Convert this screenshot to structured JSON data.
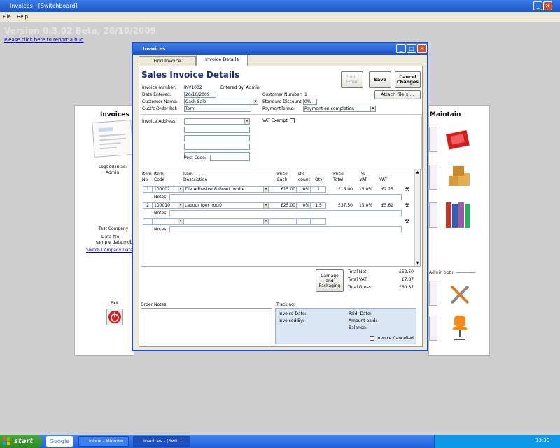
{
  "app": {
    "title": "Invoices - [Switchboard]",
    "menu": [
      "File",
      "Help"
    ],
    "version": "Version 0.3.02 Beta, 28/10/2009",
    "bug_link": "Please click here to report a bug"
  },
  "left_panel": {
    "title": "Invoices",
    "logged_in_label": "Logged in as:",
    "user": "Admin",
    "company": "Test Company",
    "data_file_label": "Data file:",
    "data_file": "sample data.mdb",
    "switch_link": "Switch Company Data",
    "exit_label": "Exit"
  },
  "right_panel": {
    "title": "Maintain",
    "admin_options": "Admin options"
  },
  "dialog": {
    "title": "Invoices",
    "tabs": [
      "Find Invoice",
      "Invoice Details"
    ],
    "active_tab": "Invoice Details",
    "heading": "Sales Invoice Details",
    "buttons": {
      "print": "Print / Email",
      "save": "Save",
      "cancel": "Cancel Changes",
      "attach": "Attach file(s)...",
      "carriage": "Carriage and Packaging"
    },
    "fields": {
      "invoice_number_label": "Invoice number:",
      "invoice_number": "INV1002",
      "entered_by": "Entered By: Admin",
      "date_entered_label": "Date Entered:",
      "date_entered": "26/10/2009",
      "customer_name_label": "Customer Name:",
      "customer_name": "Cash Sale",
      "order_ref_label": "Cust's Order Ref:",
      "order_ref": "Tom",
      "customer_number_label": "Customer Number:",
      "customer_number": "1",
      "discount_label": "Standard Discount:",
      "discount": "0%",
      "payment_terms_label": "PaymentTerms:",
      "payment_terms": "Payment on completion",
      "invoice_address_label": "Invoice Address:",
      "post_code_label": "Post Code:",
      "vat_exempt_label": "VAT Exempt"
    },
    "table": {
      "headers": {
        "no": "Item No",
        "code": "Item Code",
        "desc": "Item Description",
        "price_each": "Price Each",
        "discount": "Dis- count",
        "qty": "Qty",
        "price_total": "Price Total",
        "vat_pct": "% VAT",
        "vat": "VAT"
      },
      "notes_label": "Notes:",
      "rows": [
        {
          "no": "1",
          "code": "100002",
          "desc": "Tile Adhesive & Grout, white",
          "price": "£15.00",
          "disc": "0%",
          "qty": "1",
          "total": "£15.00",
          "vat_pct": "15.0%",
          "vat": "£2.25"
        },
        {
          "no": "2",
          "code": "100010",
          "desc": "Labour (per hour)",
          "price": "£25.00",
          "disc": "0%",
          "qty": "1.5",
          "total": "£37.50",
          "vat_pct": "15.0%",
          "vat": "£5.62"
        }
      ]
    },
    "totals": {
      "net_label": "Total Net:",
      "net": "£52.50",
      "vat_label": "Total VAT:",
      "vat": "£7.87",
      "gross_label": "Total Gross:",
      "gross": "£60.37"
    },
    "order_notes_label": "Order Notes:",
    "tracking": {
      "label": "Tracking:",
      "invoice_date": "Invoice Date:",
      "invoiced_by": "Invoiced By:",
      "paid_date": "Paid, Date:",
      "amount_paid": "Amount paid:",
      "balance": "Balance:",
      "cancelled": "Invoice Cancelled"
    }
  },
  "taskbar": {
    "start": "start",
    "google": "Google",
    "items": [
      "Inbox - Microso...",
      "Invoices - [Swit..."
    ],
    "clock": "13:30"
  },
  "colors": {
    "title_blue": "#2458d0",
    "heading_blue": "#1f2d8a",
    "taskbar_blue": "#245edb",
    "start_green": "#3a9a2f"
  }
}
